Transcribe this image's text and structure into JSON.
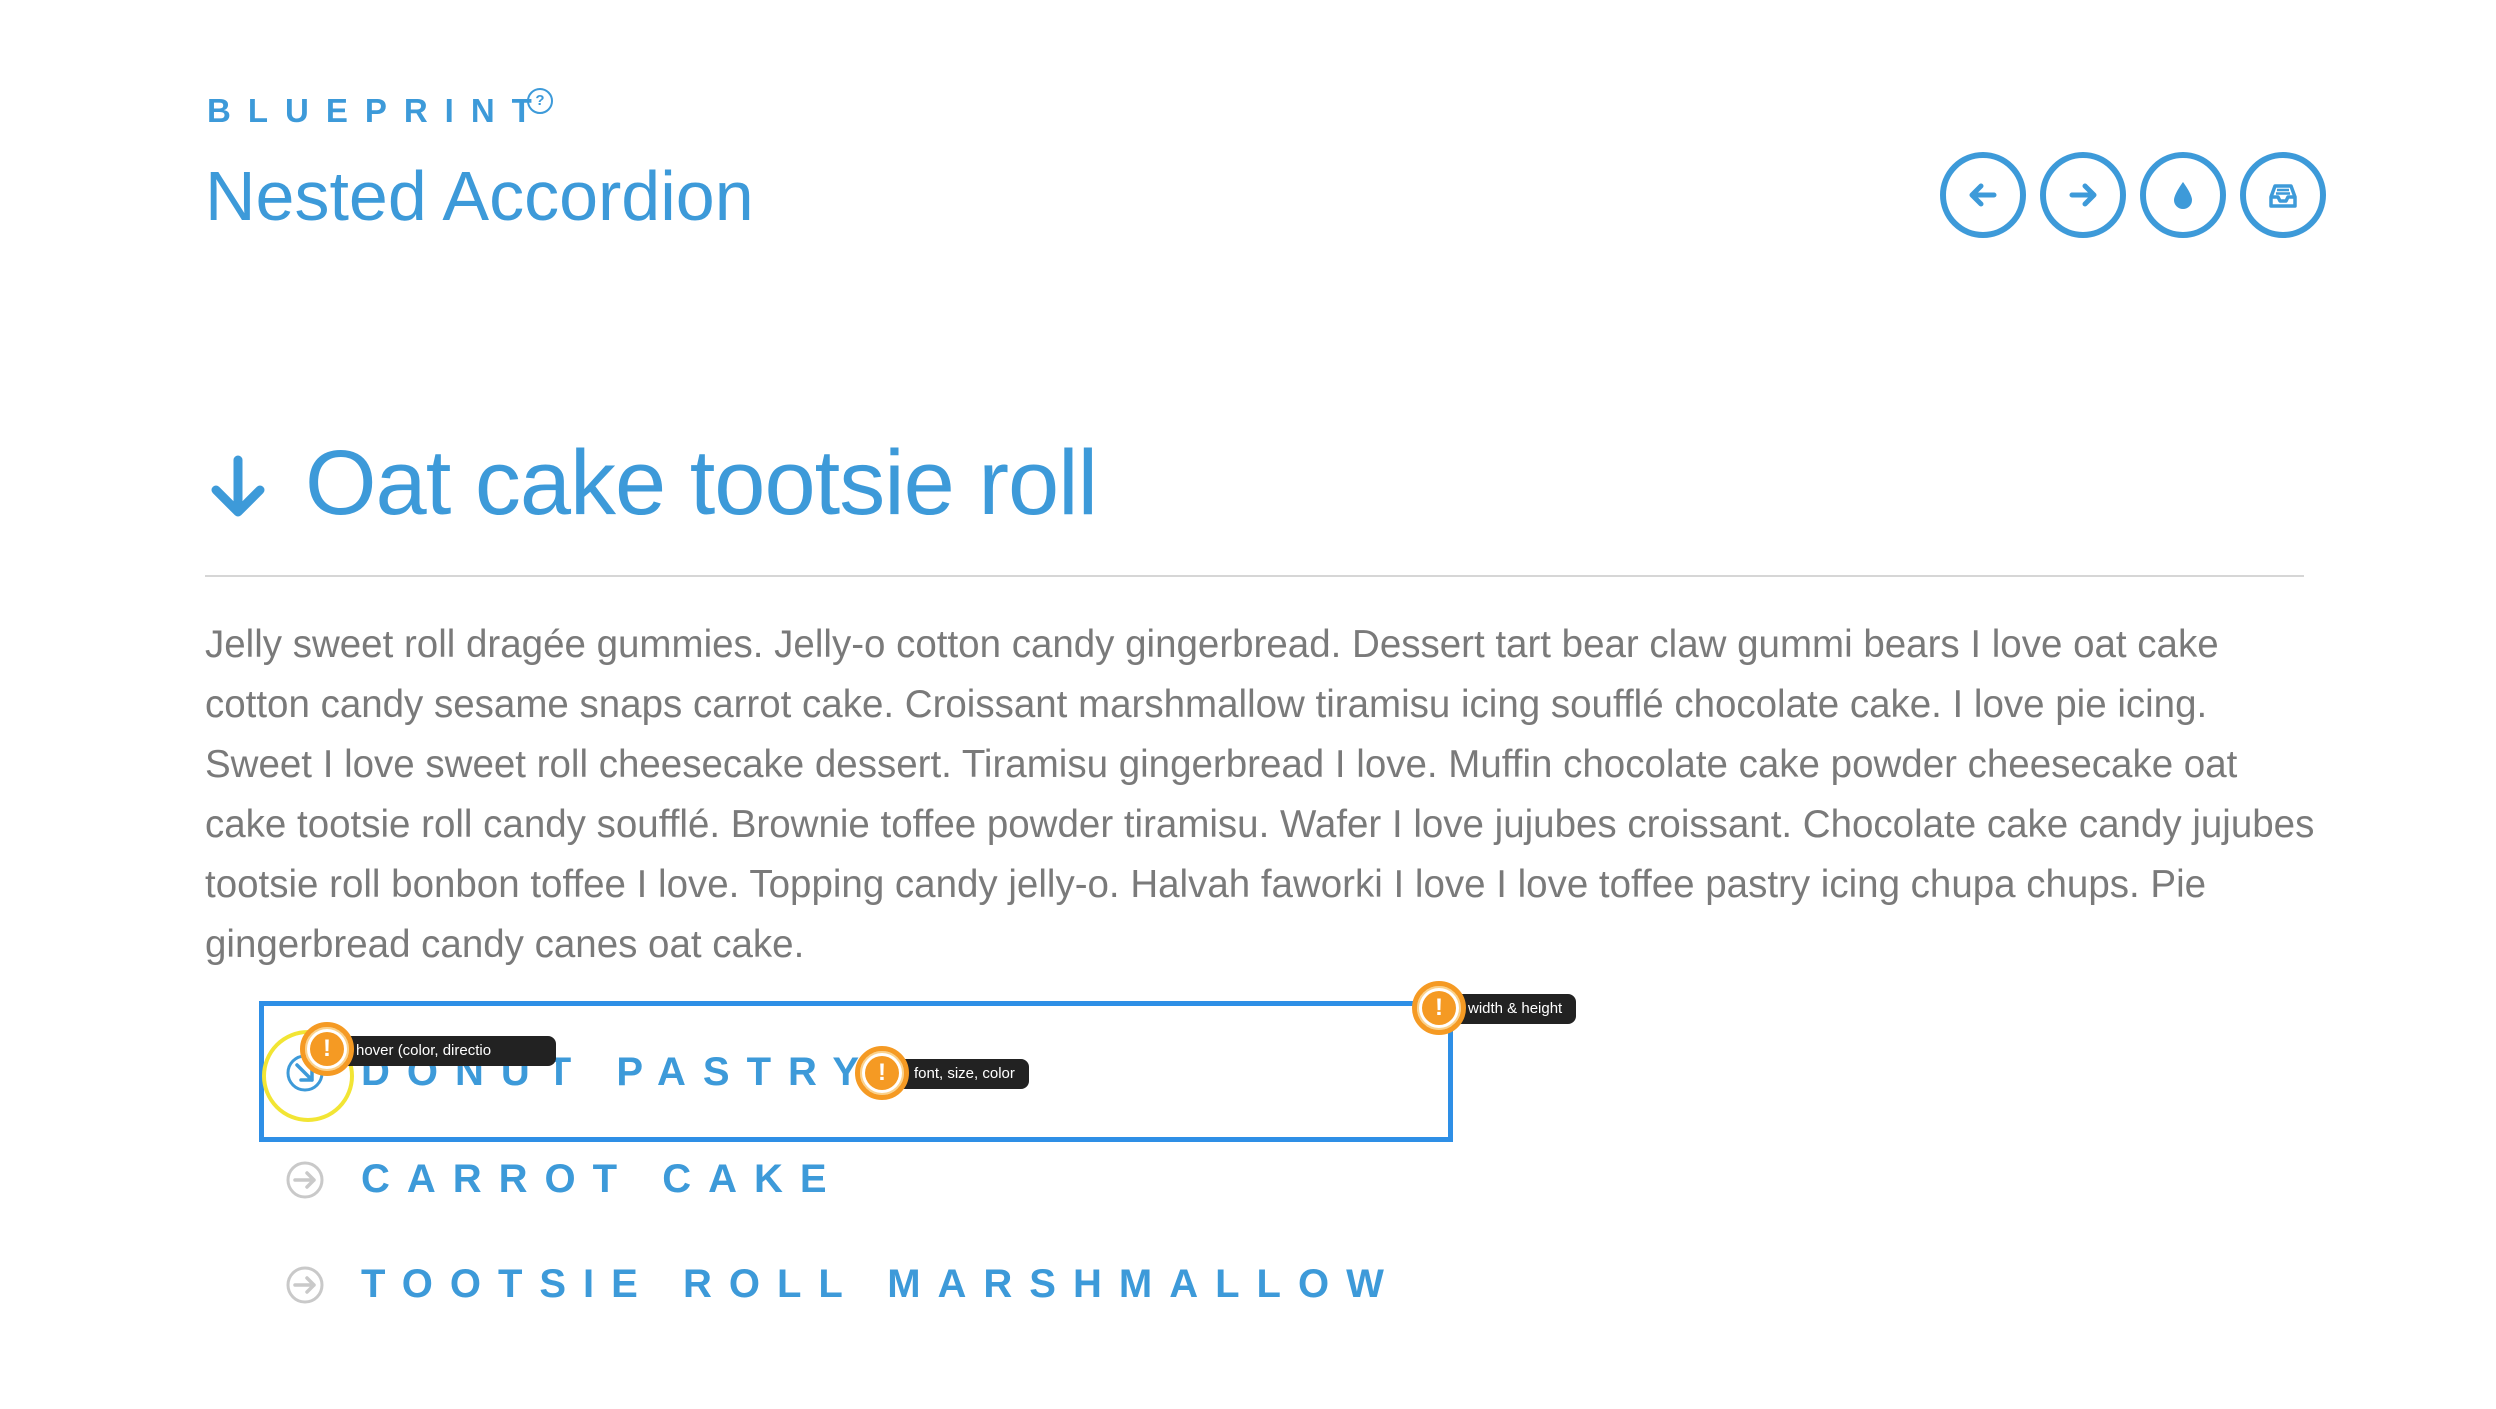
{
  "header": {
    "brand": "BLUEPRINT",
    "brand_help_glyph": "?",
    "title": "Nested Accordion",
    "nav_buttons": [
      {
        "icon": "arrow-left-icon"
      },
      {
        "icon": "arrow-right-icon"
      },
      {
        "icon": "drop-icon"
      },
      {
        "icon": "inbox-icon"
      }
    ]
  },
  "section": {
    "icon": "arrow-down-icon",
    "title": "Oat cake tootsie roll",
    "body": "Jelly sweet roll dragée gummies. Jelly-o cotton candy gingerbread. Dessert tart bear claw gummi bears I love oat cake cotton candy sesame snaps carrot cake. Croissant marshmallow tiramisu icing soufflé chocolate cake. I love pie icing. Sweet I love sweet roll cheesecake dessert. Tiramisu gingerbread I love. Muffin chocolate cake powder cheesecake oat cake tootsie roll candy soufflé. Brownie toffee powder tiramisu. Wafer I love jujubes croissant. Chocolate cake candy jujubes tootsie roll bonbon toffee I love. Topping candy jelly-o. Halvah faworki I love I love toffee pastry icing chupa chups. Pie gingerbread candy canes oat cake."
  },
  "accordion": {
    "items": [
      {
        "label": "DONUT PASTRY",
        "icon": "arrow-circle-right-icon",
        "state": "hover"
      },
      {
        "label": "CARROT CAKE",
        "icon": "arrow-circle-right-icon",
        "state": "default"
      },
      {
        "label": "TOOTSIE ROLL MARSHMALLOW",
        "icon": "arrow-circle-right-icon",
        "state": "default"
      }
    ]
  },
  "annotations": {
    "marker_glyph": "!",
    "hover": "hover (color, directio",
    "font": "font, size, color",
    "size": "width & height"
  },
  "colors": {
    "accent": "#3d9ad9",
    "selection": "#2e8fe6",
    "marker": "#f59a23",
    "hover_ring": "#f2e534",
    "body_text": "#7a7a7a"
  }
}
